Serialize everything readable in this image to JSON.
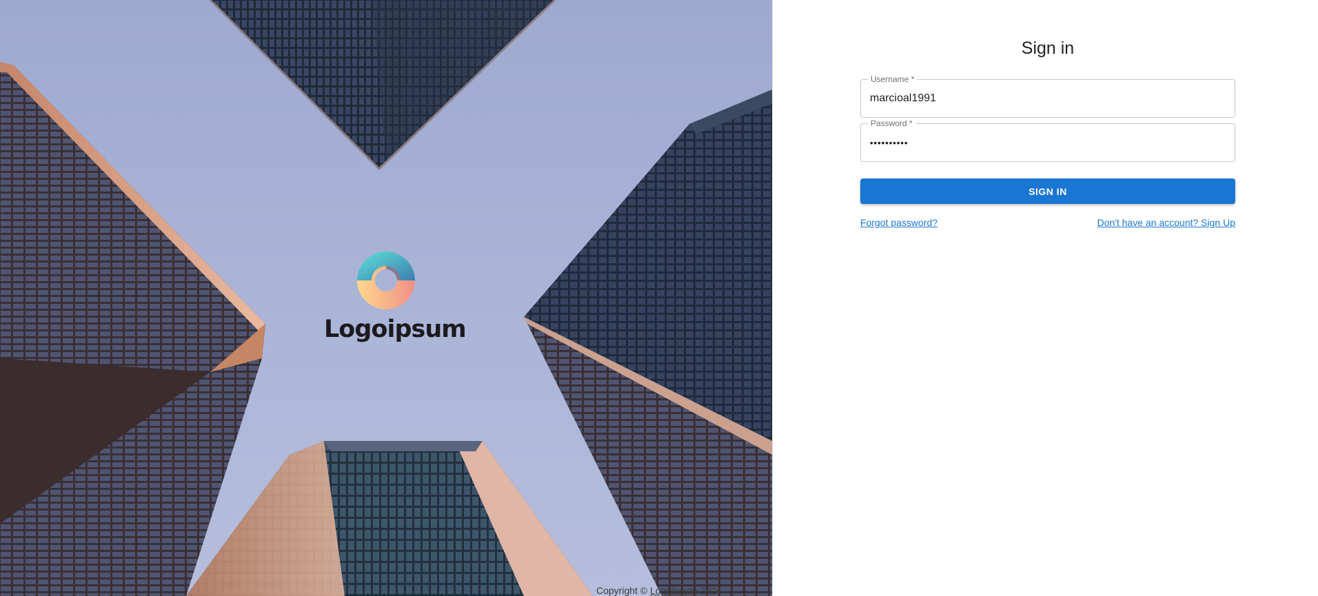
{
  "branding": {
    "logo_text": "Logoipsum",
    "logo_icon": "circular-swirl-logo-icon"
  },
  "colors": {
    "primary": "#1976d2",
    "sky": "#a9b3d6",
    "logo_teal": "#6fd6d6",
    "logo_peach": "#f8c98a",
    "logo_coral": "#f29a82"
  },
  "signin": {
    "title": "Sign in",
    "username_label": "Username *",
    "username_value": "marcioal1991",
    "password_label": "Password *",
    "password_value": "••••••••••",
    "button_label": "SIGN IN",
    "forgot_link": "Forgot password?",
    "signup_link": "Don't have an account? Sign Up"
  },
  "footer": {
    "prefix": "Copyright ©",
    "link": "Logoipsum",
    "year": "2024."
  }
}
